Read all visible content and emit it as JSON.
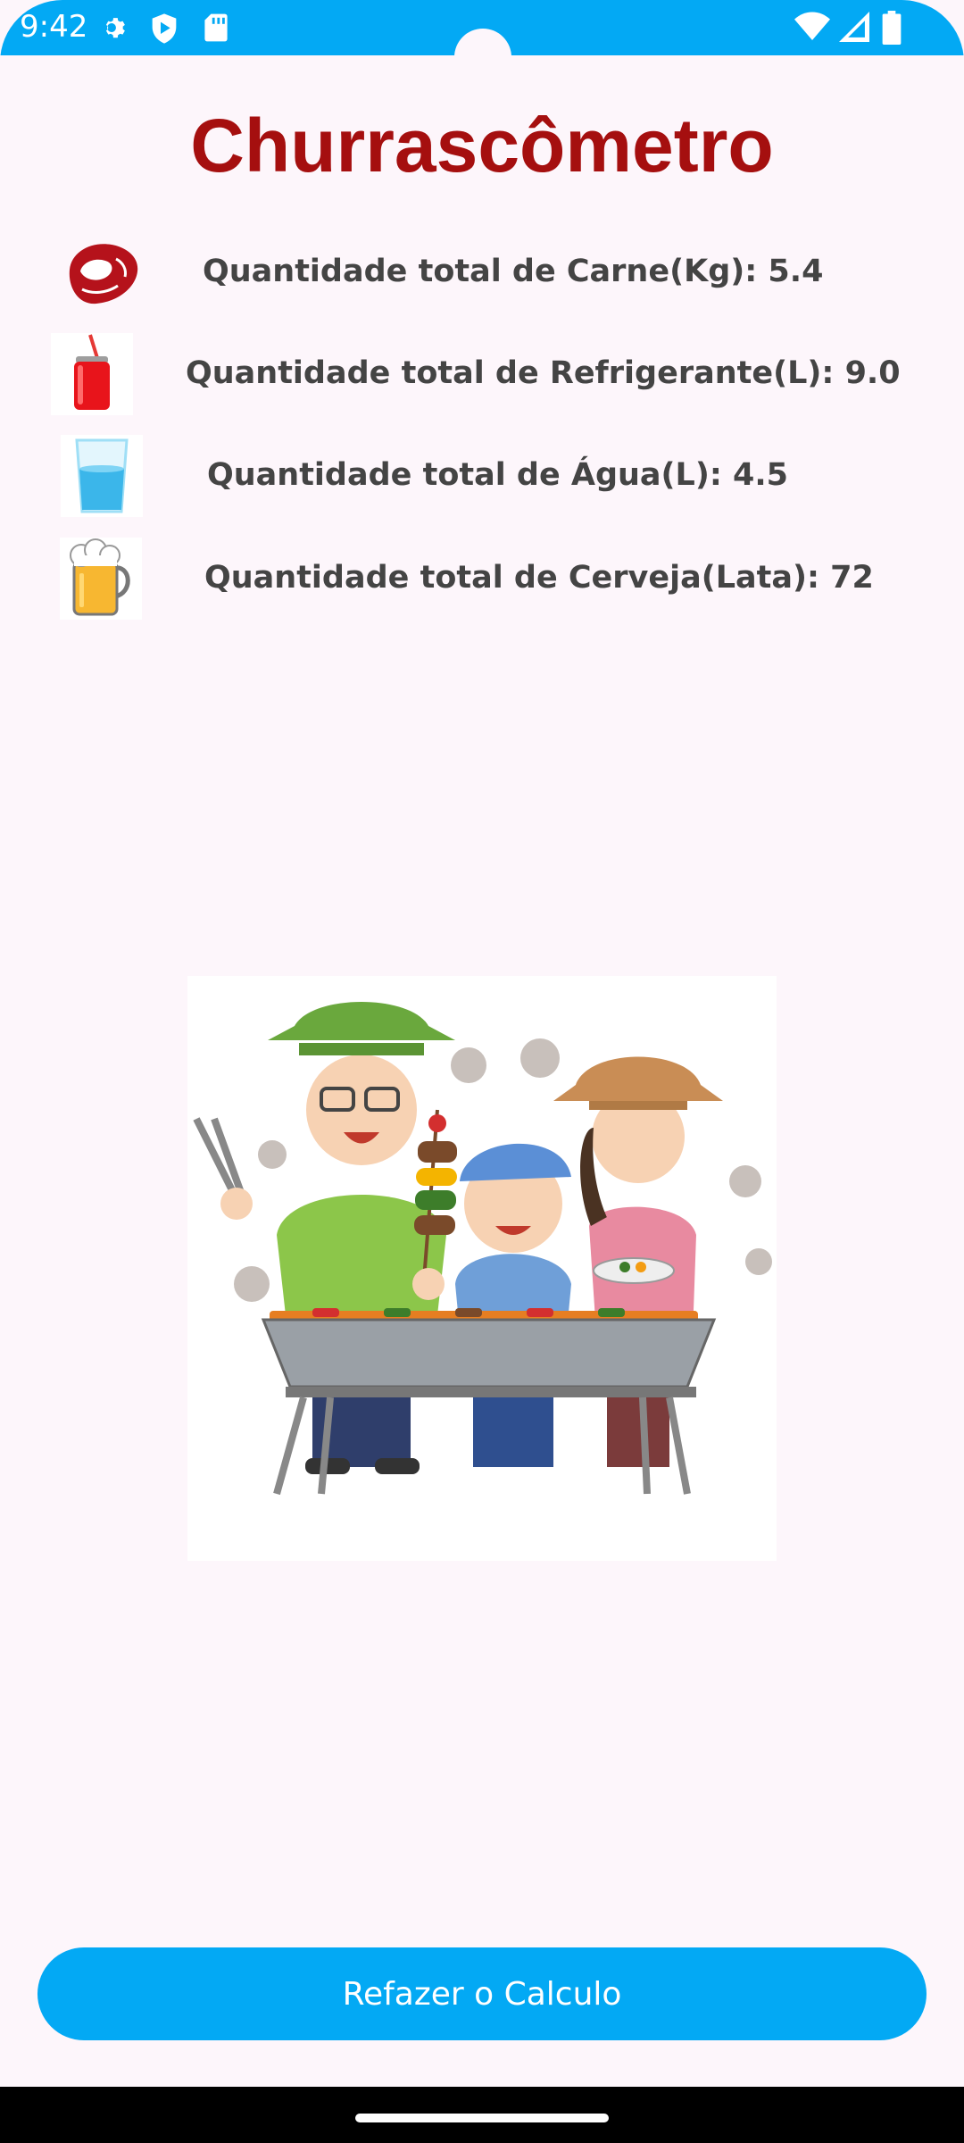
{
  "status_bar": {
    "time": "9:42",
    "icons_left": [
      "gear-icon",
      "shield-icon",
      "sd-card-icon"
    ],
    "icons_right": [
      "wifi-icon",
      "signal-icon",
      "battery-icon"
    ]
  },
  "app": {
    "title": "Churrascômetro"
  },
  "results": [
    {
      "icon": "meat-icon",
      "label": "Quantidade total de Carne(Kg): 5.4"
    },
    {
      "icon": "soda-can-icon",
      "label": "Quantidade total de Refrigerante(L): 9.0"
    },
    {
      "icon": "water-glass-icon",
      "label": "Quantidade total de Água(L): 4.5"
    },
    {
      "icon": "beer-mug-icon",
      "label": "Quantidade total de Cerveja(Lata): 72"
    }
  ],
  "illustration": {
    "icon": "barbecue-family-illustration"
  },
  "actions": {
    "redo_label": "Refazer o Calculo"
  },
  "colors": {
    "accent": "#03a9f4",
    "title": "#a50f0f",
    "background": "#fdf6fb",
    "text": "#444444"
  }
}
